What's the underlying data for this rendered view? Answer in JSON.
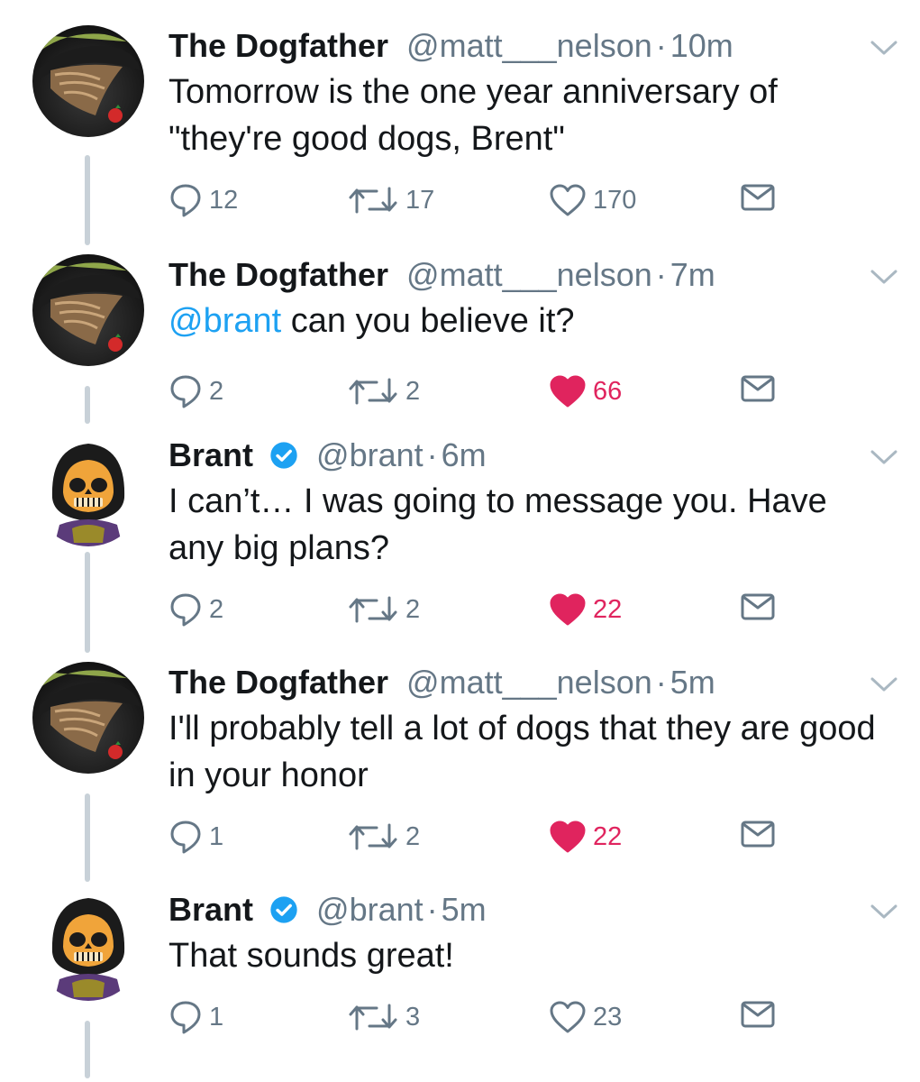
{
  "colors": {
    "accent": "#1da1f2",
    "like": "#e0245e",
    "muted": "#657786",
    "text": "#14171a",
    "thread": "#c8d1d8"
  },
  "tweets": [
    {
      "name": "The Dogfather",
      "verified": false,
      "handle": "@matt___nelson",
      "separator": "·",
      "time": "10m",
      "mention": "",
      "text": "Tomorrow is the one year anniversary of \"they're good dogs, Brent\"",
      "replies": "12",
      "retweets": "17",
      "likes": "170",
      "liked": false,
      "avatar": "dogfather-avatar"
    },
    {
      "name": "The Dogfather",
      "verified": false,
      "handle": "@matt___nelson",
      "separator": "·",
      "time": "7m",
      "mention": "@brant",
      "text": " can you believe it?",
      "replies": "2",
      "retweets": "2",
      "likes": "66",
      "liked": true,
      "avatar": "dogfather-avatar"
    },
    {
      "name": "Brant",
      "verified": true,
      "handle": "@brant",
      "separator": "·",
      "time": "6m",
      "mention": "",
      "text": "I can’t… I was going to message you. Have any big plans?",
      "replies": "2",
      "retweets": "2",
      "likes": "22",
      "liked": true,
      "avatar": "skeletor-avatar"
    },
    {
      "name": "The Dogfather",
      "verified": false,
      "handle": "@matt___nelson",
      "separator": "·",
      "time": "5m",
      "mention": "",
      "text": "I'll probably tell a lot of dogs that they are good in your honor",
      "replies": "1",
      "retweets": "2",
      "likes": "22",
      "liked": true,
      "avatar": "dogfather-avatar"
    },
    {
      "name": "Brant",
      "verified": true,
      "handle": "@brant",
      "separator": "·",
      "time": "5m",
      "mention": "",
      "text": "That sounds great!",
      "replies": "1",
      "retweets": "3",
      "likes": "23",
      "liked": false,
      "avatar": "skeletor-avatar"
    }
  ]
}
